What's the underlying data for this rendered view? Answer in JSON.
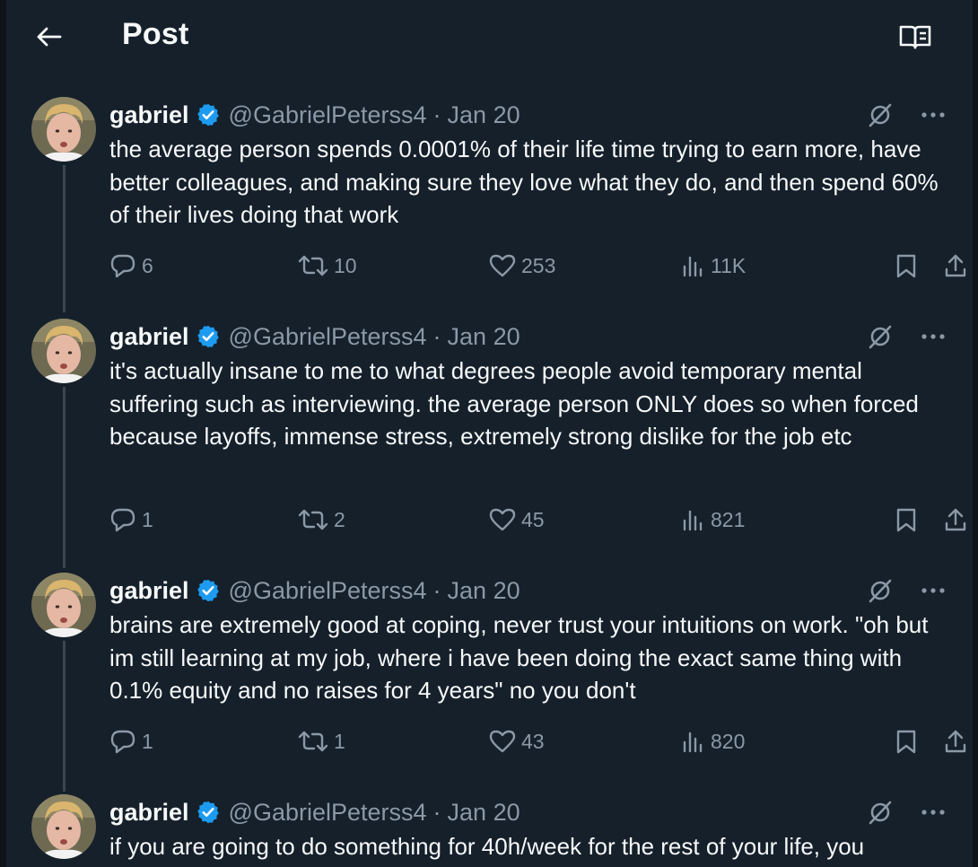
{
  "header": {
    "title": "Post",
    "back_icon": "arrow-left-icon",
    "reader_icon": "open-book-icon"
  },
  "colors": {
    "background": "#15202b",
    "text": "#f7f9f9",
    "muted": "#8b98a5",
    "verified": "#1d9bf0",
    "thread_line": "#3a4652"
  },
  "tweets": [
    {
      "name": "gabriel",
      "handle": "@GabrielPeterss4",
      "sep": "·",
      "date": "Jan 20",
      "text": "the average person spends 0.0001% of their life time trying to earn more, have better colleagues, and making sure they love what they do, and then spend 60% of their lives doing that work",
      "replies": "6",
      "retweets": "10",
      "likes": "253",
      "views": "11K"
    },
    {
      "name": "gabriel",
      "handle": "@GabrielPeterss4",
      "sep": "·",
      "date": "Jan 20",
      "text": "it's actually insane to me to what degrees people avoid temporary mental suffering such as interviewing. the average person ONLY does so when forced because layoffs, immense stress, extremely strong dislike for the job etc",
      "replies": "1",
      "retweets": "2",
      "likes": "45",
      "views": "821"
    },
    {
      "name": "gabriel",
      "handle": "@GabrielPeterss4",
      "sep": "·",
      "date": "Jan 20",
      "text": "brains are extremely good at coping, never trust your intuitions on work. \"oh but im still learning at my job, where i have been doing the exact same thing with 0.1% equity and no raises for 4 years\" no you don't",
      "replies": "1",
      "retweets": "1",
      "likes": "43",
      "views": "820"
    },
    {
      "name": "gabriel",
      "handle": "@GabrielPeterss4",
      "sep": "·",
      "date": "Jan 20",
      "text": "if you are going to do something for 40h/week for the rest of your life, you"
    }
  ]
}
